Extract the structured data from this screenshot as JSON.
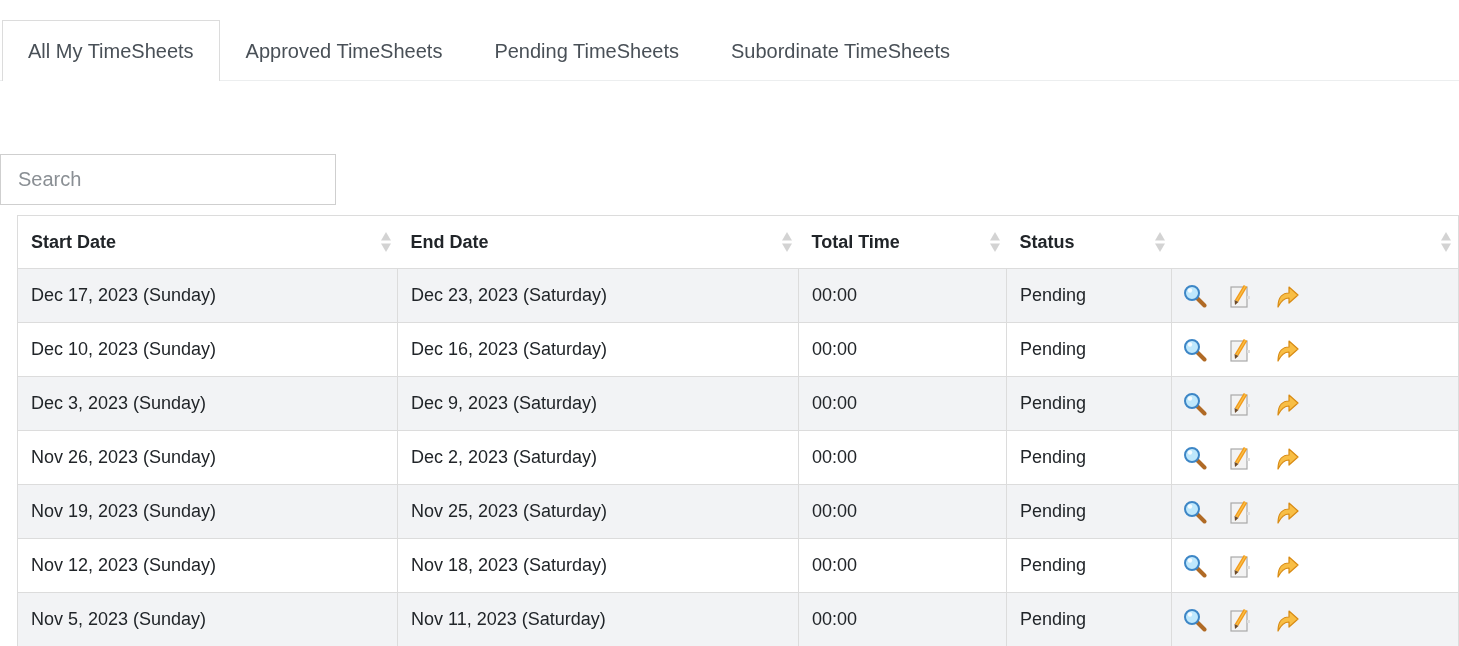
{
  "tabs": [
    {
      "label": "All My TimeSheets",
      "selected": true
    },
    {
      "label": "Approved TimeSheets",
      "selected": false
    },
    {
      "label": "Pending TimeSheets",
      "selected": false
    },
    {
      "label": "Subordinate TimeSheets",
      "selected": false
    }
  ],
  "search": {
    "placeholder": "Search"
  },
  "table": {
    "columns": [
      "Start Date",
      "End Date",
      "Total Time",
      "Status"
    ],
    "rows": [
      {
        "start_date": "Dec 17, 2023 (Sunday)",
        "end_date": "Dec 23, 2023 (Saturday)",
        "total_time": "00:00",
        "status": "Pending"
      },
      {
        "start_date": "Dec 10, 2023 (Sunday)",
        "end_date": "Dec 16, 2023 (Saturday)",
        "total_time": "00:00",
        "status": "Pending"
      },
      {
        "start_date": "Dec 3, 2023 (Sunday)",
        "end_date": "Dec 9, 2023 (Saturday)",
        "total_time": "00:00",
        "status": "Pending"
      },
      {
        "start_date": "Nov 26, 2023 (Sunday)",
        "end_date": "Dec 2, 2023 (Saturday)",
        "total_time": "00:00",
        "status": "Pending"
      },
      {
        "start_date": "Nov 19, 2023 (Sunday)",
        "end_date": "Nov 25, 2023 (Saturday)",
        "total_time": "00:00",
        "status": "Pending"
      },
      {
        "start_date": "Nov 12, 2023 (Sunday)",
        "end_date": "Nov 18, 2023 (Saturday)",
        "total_time": "00:00",
        "status": "Pending"
      },
      {
        "start_date": "Nov 5, 2023 (Sunday)",
        "end_date": "Nov 11, 2023 (Saturday)",
        "total_time": "00:00",
        "status": "Pending"
      }
    ]
  }
}
